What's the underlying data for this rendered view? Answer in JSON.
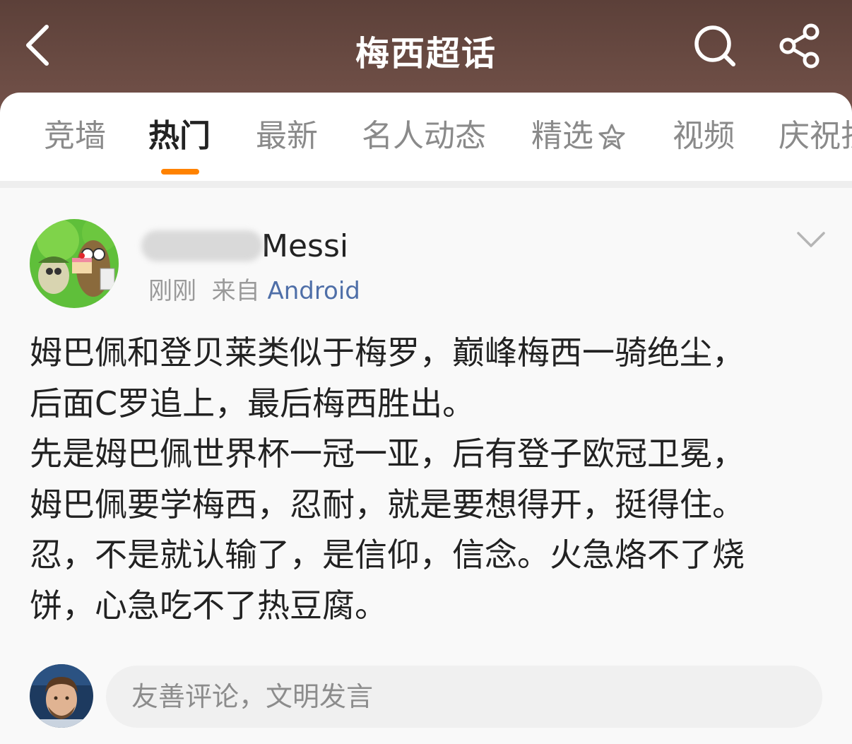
{
  "header": {
    "title": "梅西超话",
    "background_color": "#654740",
    "back_icon": "chevron-left-icon",
    "search_icon": "search-icon",
    "share_icon": "share-icon"
  },
  "tabs": {
    "active_index": 1,
    "active_color": "#ff8200",
    "items": [
      {
        "label": "竞墙"
      },
      {
        "label": "热门"
      },
      {
        "label": "最新"
      },
      {
        "label": "名人动态"
      },
      {
        "label": "精选",
        "badge_icon": "star-badge-icon"
      },
      {
        "label": "视频"
      },
      {
        "label": "庆祝折"
      }
    ]
  },
  "post": {
    "author": {
      "name_suffix": "Messi",
      "name_prefix_blurred": true
    },
    "time": "刚刚",
    "source_prefix": "来自",
    "source_app": "Android",
    "body_lines": [
      "姆巴佩和登贝莱类似于梅罗，巅峰梅西一骑绝尘，",
      "后面C罗追上，最后梅西胜出。",
      "先是姆巴佩世界杯一冠一亚，后有登子欧冠卫冕，",
      "姆巴佩要学梅西，忍耐，就是要想得开，挺得住。",
      "忍，不是就认输了，是信仰，信念。火急烙不了烧",
      "饼，心急吃不了热豆腐。"
    ]
  },
  "comment": {
    "placeholder": "友善评论，文明发言",
    "value": ""
  }
}
